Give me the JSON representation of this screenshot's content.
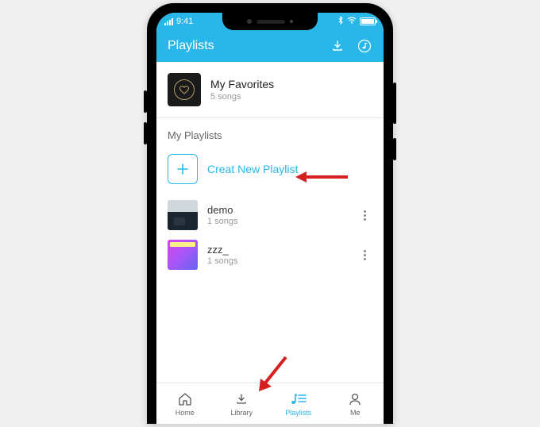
{
  "statusBar": {
    "time": "9:41"
  },
  "header": {
    "title": "Playlists"
  },
  "favorites": {
    "title": "My Favorites",
    "sub": "5 songs"
  },
  "sectionLabel": "My Playlists",
  "createLabel": "Creat New Playlist",
  "playlists": [
    {
      "title": "demo",
      "sub": "1 songs"
    },
    {
      "title": "zzz_",
      "sub": "1 songs"
    }
  ],
  "nav": {
    "home": "Home",
    "library": "Library",
    "playlists": "Playlists",
    "me": "Me"
  }
}
